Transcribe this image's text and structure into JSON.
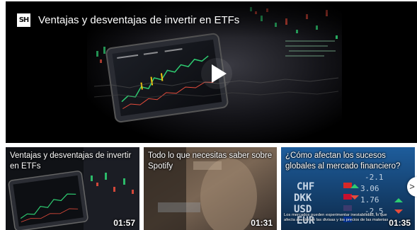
{
  "player": {
    "channel_logo_text": "SH",
    "title": "Ventajas y desventajas de invertir en ETFs",
    "play_icon": "play-icon"
  },
  "thumbnails": [
    {
      "title": "Ventajas y desventajas de invertir en ETFs",
      "duration": "01:57",
      "caption": ""
    },
    {
      "title": "Todo lo que necesitas saber sobre Spotify",
      "duration": "01:31",
      "caption": ""
    },
    {
      "title": "¿Cómo afectan los sucesos globales al mercado financiero?",
      "duration": "01:35",
      "caption": "Los mercados pueden experimentar inestabilidad, lo que afecta al valor de las divisas y los precios de las materias"
    }
  ],
  "next_arrow": {
    "label": ">",
    "icon": "chevron-right-icon"
  },
  "colors": {
    "overlay_text": "#ffffff",
    "player_background": "#000000",
    "market_green": "#2ecc71",
    "market_red": "#e74c3c"
  }
}
